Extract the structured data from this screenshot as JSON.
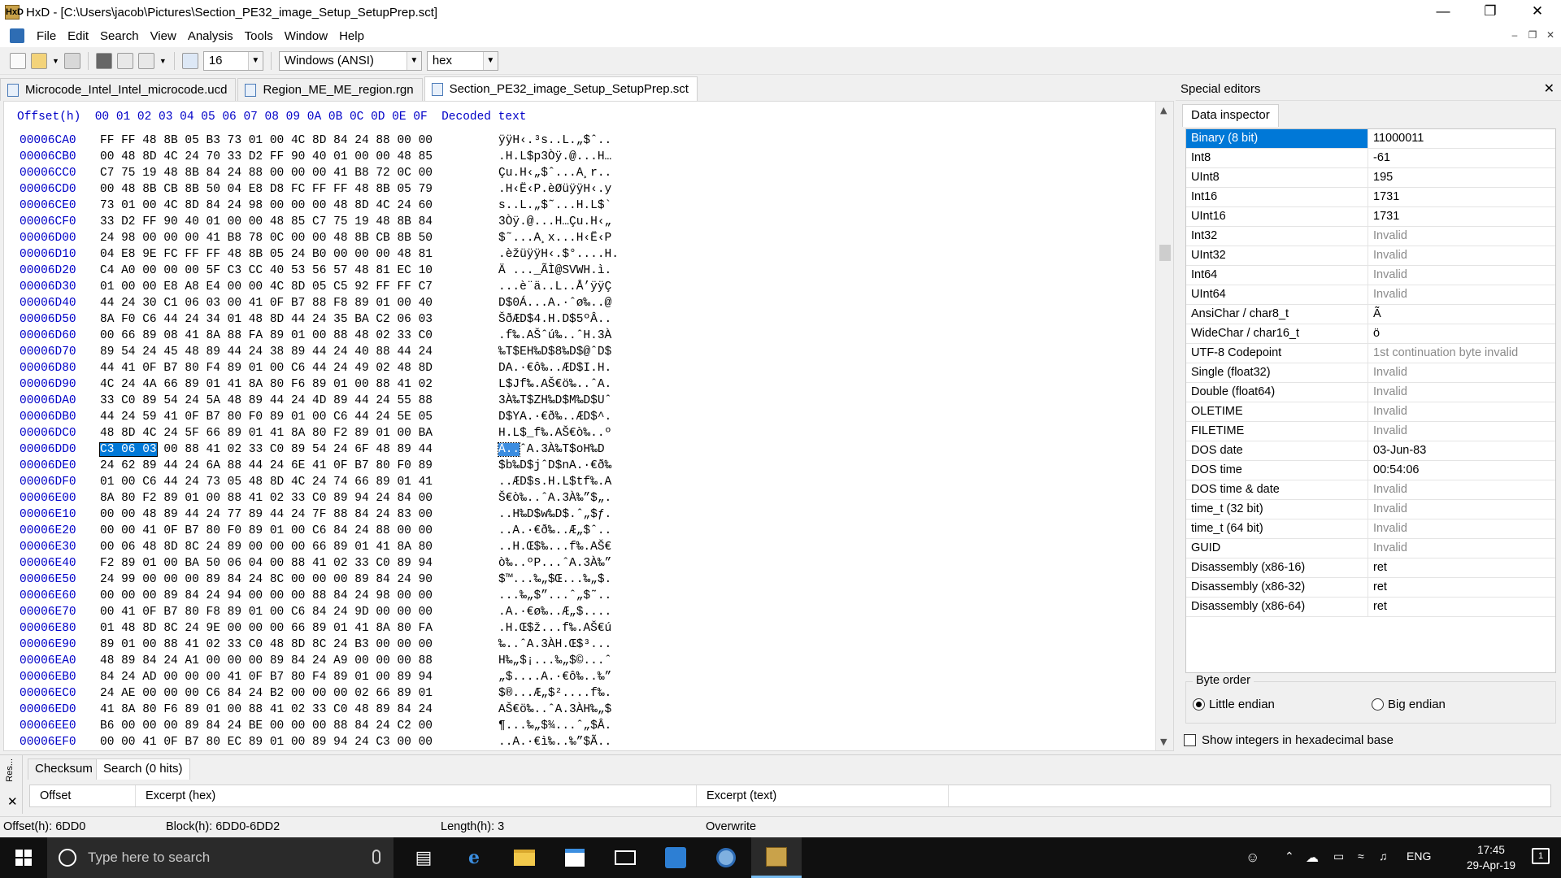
{
  "window": {
    "title": "HxD - [C:\\Users\\jacob\\Pictures\\Section_PE32_image_Setup_SetupPrep.sct]",
    "app_icon_text": "HxD"
  },
  "menu": [
    "File",
    "Edit",
    "Search",
    "View",
    "Analysis",
    "Tools",
    "Window",
    "Help"
  ],
  "toolbar": {
    "bytes_per_row": "16",
    "charset": "Windows (ANSI)",
    "base": "hex"
  },
  "tabs": [
    {
      "label": "Microcode_Intel_Intel_microcode.ucd",
      "active": false
    },
    {
      "label": "Region_ME_ME_region.rgn",
      "active": false
    },
    {
      "label": "Section_PE32_image_Setup_SetupPrep.sct",
      "active": true
    }
  ],
  "hex_header": "Offset(h)  00 01 02 03 04 05 06 07 08 09 0A 0B 0C 0D 0E 0F  Decoded text",
  "hex_rows": [
    {
      "offset": "00006CA0",
      "hex": "FF FF 48 8B 05 B3 73 01 00 4C 8D 84 24 88 00 00",
      "text": "ÿÿH‹.³s..L.„$ˆ.."
    },
    {
      "offset": "00006CB0",
      "hex": "00 48 8D 4C 24 70 33 D2 FF 90 40 01 00 00 48 85",
      "text": ".H.L$p3Òÿ.@...H…"
    },
    {
      "offset": "00006CC0",
      "hex": "C7 75 19 48 8B 84 24 88 00 00 00 41 B8 72 0C 00",
      "text": "Çu.H‹„$ˆ...A¸r.."
    },
    {
      "offset": "00006CD0",
      "hex": "00 48 8B CB 8B 50 04 E8 D8 FC FF FF 48 8B 05 79",
      "text": ".H‹Ë‹P.èØüÿÿH‹.y"
    },
    {
      "offset": "00006CE0",
      "hex": "73 01 00 4C 8D 84 24 98 00 00 00 48 8D 4C 24 60",
      "text": "s..L.„$˜...H.L$`"
    },
    {
      "offset": "00006CF0",
      "hex": "33 D2 FF 90 40 01 00 00 48 85 C7 75 19 48 8B 84",
      "text": "3Òÿ.@...H…Çu.H‹„"
    },
    {
      "offset": "00006D00",
      "hex": "24 98 00 00 00 41 B8 78 0C 00 00 48 8B CB 8B 50",
      "text": "$˜...A¸x...H‹Ë‹P"
    },
    {
      "offset": "00006D10",
      "hex": "04 E8 9E FC FF FF 48 8B 05 24 B0 00 00 00 48 81",
      "text": ".èžüÿÿH‹.$°....H."
    },
    {
      "offset": "00006D20",
      "hex": "C4 A0 00 00 00 5F C3 CC 40 53 56 57 48 81 EC 10",
      "text": "Ä ..._ÃÌ@SVWH.ì."
    },
    {
      "offset": "00006D30",
      "hex": "01 00 00 E8 A8 E4 00 00 4C 8D 05 C5 92 FF FF C7",
      "text": "...è¨ä..L..Å’ÿÿÇ"
    },
    {
      "offset": "00006D40",
      "hex": "44 24 30 C1 06 03 00 41 0F B7 88 F8 89 01 00 40",
      "text": "D$0Á...A.·ˆø‰..@"
    },
    {
      "offset": "00006D50",
      "hex": "8A F0 C6 44 24 34 01 48 8D 44 24 35 BA C2 06 03",
      "text": "ŠðÆD$4.H.D$5ºÂ.."
    },
    {
      "offset": "00006D60",
      "hex": "00 66 89 08 41 8A 88 FA 89 01 00 88 48 02 33 C0",
      "text": ".f‰.AŠˆú‰..ˆH.3À"
    },
    {
      "offset": "00006D70",
      "hex": "89 54 24 45 48 89 44 24 38 89 44 24 40 88 44 24",
      "text": "‰T$EH‰D$8‰D$@ˆD$"
    },
    {
      "offset": "00006D80",
      "hex": "44 41 0F B7 80 F4 89 01 00 C6 44 24 49 02 48 8D",
      "text": "DA.·€ô‰..ÆD$I.H."
    },
    {
      "offset": "00006D90",
      "hex": "4C 24 4A 66 89 01 41 8A 80 F6 89 01 00 88 41 02",
      "text": "L$Jf‰.AŠ€ö‰..ˆA."
    },
    {
      "offset": "00006DA0",
      "hex": "33 C0 89 54 24 5A 48 89 44 24 4D 89 44 24 55 88",
      "text": "3À‰T$ZH‰D$M‰D$Uˆ"
    },
    {
      "offset": "00006DB0",
      "hex": "44 24 59 41 0F B7 80 F0 89 01 00 C6 44 24 5E 05",
      "text": "D$YA.·€ð‰..ÆD$^."
    },
    {
      "offset": "00006DC0",
      "hex": "48 8D 4C 24 5F 66 89 01 41 8A 80 F2 89 01 00 BA",
      "text": "H.L$_f‰.AŠ€ò‰..º"
    },
    {
      "offset": "00006DD0",
      "hex": "C3 06 03 00 88 41 02 33 C0 89 54 24 6F 48 89 44",
      "text": "Ã..ˆA.3À‰T$oH‰D"
    },
    {
      "offset": "00006DE0",
      "hex": "24 62 89 44 24 6A 88 44 24 6E 41 0F B7 80 F0 89",
      "text": "$b‰D$jˆD$nA.·€ð‰"
    },
    {
      "offset": "00006DF0",
      "hex": "01 00 C6 44 24 73 05 48 8D 4C 24 74 66 89 01 41",
      "text": "..ÆD$s.H.L$tf‰.A"
    },
    {
      "offset": "00006E00",
      "hex": "8A 80 F2 89 01 00 88 41 02 33 C0 89 94 24 84 00",
      "text": "Š€ò‰..ˆA.3À‰”$„."
    },
    {
      "offset": "00006E10",
      "hex": "00 00 48 89 44 24 77 89 44 24 7F 88 84 24 83 00",
      "text": "..H‰D$w‰D$.ˆ„$ƒ."
    },
    {
      "offset": "00006E20",
      "hex": "00 00 41 0F B7 80 F0 89 01 00 C6 84 24 88 00 00",
      "text": "..A.·€ð‰..Æ„$ˆ.."
    },
    {
      "offset": "00006E30",
      "hex": "00 06 48 8D 8C 24 89 00 00 00 66 89 01 41 8A 80",
      "text": "..H.Œ$‰...f‰.AŠ€"
    },
    {
      "offset": "00006E40",
      "hex": "F2 89 01 00 BA 50 06 04 00 88 41 02 33 C0 89 94",
      "text": "ò‰..ºP...ˆA.3À‰”"
    },
    {
      "offset": "00006E50",
      "hex": "24 99 00 00 00 89 84 24 8C 00 00 00 89 84 24 90",
      "text": "$™...‰„$Œ...‰„$."
    },
    {
      "offset": "00006E60",
      "hex": "00 00 00 89 84 24 94 00 00 00 88 84 24 98 00 00",
      "text": "...‰„$”...ˆ„$˜.."
    },
    {
      "offset": "00006E70",
      "hex": "00 41 0F B7 80 F8 89 01 00 C6 84 24 9D 00 00 00",
      "text": ".A.·€ø‰..Æ„$...."
    },
    {
      "offset": "00006E80",
      "hex": "01 48 8D 8C 24 9E 00 00 00 66 89 01 41 8A 80 FA",
      "text": ".H.Œ$ž...f‰.AŠ€ú"
    },
    {
      "offset": "00006E90",
      "hex": "89 01 00 88 41 02 33 C0 48 8D 8C 24 B3 00 00 00",
      "text": "‰..ˆA.3ÀH.Œ$³..."
    },
    {
      "offset": "00006EA0",
      "hex": "48 89 84 24 A1 00 00 00 89 84 24 A9 00 00 00 88",
      "text": "H‰„$¡...‰„$©...ˆ"
    },
    {
      "offset": "00006EB0",
      "hex": "84 24 AD 00 00 00 41 0F B7 80 F4 89 01 00 89 94",
      "text": "„$....A.·€ô‰..‰”"
    },
    {
      "offset": "00006EC0",
      "hex": "24 AE 00 00 00 C6 84 24 B2 00 00 00 02 66 89 01",
      "text": "$®...Æ„$²....f‰."
    },
    {
      "offset": "00006ED0",
      "hex": "41 8A 80 F6 89 01 00 88 41 02 33 C0 48 89 84 24",
      "text": "AŠ€ö‰..ˆA.3ÀH‰„$"
    },
    {
      "offset": "00006EE0",
      "hex": "B6 00 00 00 89 84 24 BE 00 00 00 88 84 24 C2 00",
      "text": "¶...‰„$¾...ˆ„$Â."
    },
    {
      "offset": "00006EF0",
      "hex": "00 00 41 0F B7 80 EC 89 01 00 89 94 24 C3 00 00",
      "text": "..A.·€ì‰..‰”$Ã.."
    }
  ],
  "selection": {
    "hex": "C3 06 03",
    "text": "Ã.."
  },
  "special_editors": {
    "title": "Special editors",
    "tab": "Data inspector",
    "rows": [
      {
        "key": "Binary (8 bit)",
        "value": "11000011",
        "active": true,
        "invalid": false
      },
      {
        "key": "Int8",
        "value": "-61",
        "invalid": false
      },
      {
        "key": "UInt8",
        "value": "195",
        "invalid": false
      },
      {
        "key": "Int16",
        "value": "1731",
        "invalid": false
      },
      {
        "key": "UInt16",
        "value": "1731",
        "invalid": false
      },
      {
        "key": "Int32",
        "value": "Invalid",
        "invalid": true
      },
      {
        "key": "UInt32",
        "value": "Invalid",
        "invalid": true
      },
      {
        "key": "Int64",
        "value": "Invalid",
        "invalid": true
      },
      {
        "key": "UInt64",
        "value": "Invalid",
        "invalid": true
      },
      {
        "key": "AnsiChar / char8_t",
        "value": "Ã",
        "invalid": false
      },
      {
        "key": "WideChar / char16_t",
        "value": "ö",
        "invalid": false
      },
      {
        "key": "UTF-8 Codepoint",
        "value": "1st continuation byte invalid",
        "invalid": true
      },
      {
        "key": "Single (float32)",
        "value": "Invalid",
        "invalid": true
      },
      {
        "key": "Double (float64)",
        "value": "Invalid",
        "invalid": true
      },
      {
        "key": "OLETIME",
        "value": "Invalid",
        "invalid": true
      },
      {
        "key": "FILETIME",
        "value": "Invalid",
        "invalid": true
      },
      {
        "key": "DOS date",
        "value": "03-Jun-83",
        "invalid": false
      },
      {
        "key": "DOS time",
        "value": "00:54:06",
        "invalid": false
      },
      {
        "key": "DOS time & date",
        "value": "Invalid",
        "invalid": true
      },
      {
        "key": "time_t (32 bit)",
        "value": "Invalid",
        "invalid": true
      },
      {
        "key": "time_t (64 bit)",
        "value": "Invalid",
        "invalid": true
      },
      {
        "key": "GUID",
        "value": "Invalid",
        "invalid": true
      },
      {
        "key": "Disassembly (x86-16)",
        "value": "ret",
        "invalid": false
      },
      {
        "key": "Disassembly (x86-32)",
        "value": "ret",
        "invalid": false
      },
      {
        "key": "Disassembly (x86-64)",
        "value": "ret",
        "invalid": false
      }
    ],
    "byte_order_label": "Byte order",
    "little_endian": "Little endian",
    "big_endian": "Big endian",
    "hex_checkbox": "Show integers in hexadecimal base"
  },
  "bottom": {
    "side_label": "Res...",
    "tabs": [
      "Checksum",
      "Search (0 hits)"
    ],
    "columns": [
      "Offset",
      "Excerpt (hex)",
      "Excerpt (text)"
    ]
  },
  "status": {
    "offset": "Offset(h): 6DD0",
    "block": "Block(h): 6DD0-6DD2",
    "length": "Length(h): 3",
    "mode": "Overwrite"
  },
  "taskbar": {
    "search_placeholder": "Type here to search",
    "language": "ENG",
    "time": "17:45",
    "date": "29-Apr-19",
    "notifications": "1"
  }
}
